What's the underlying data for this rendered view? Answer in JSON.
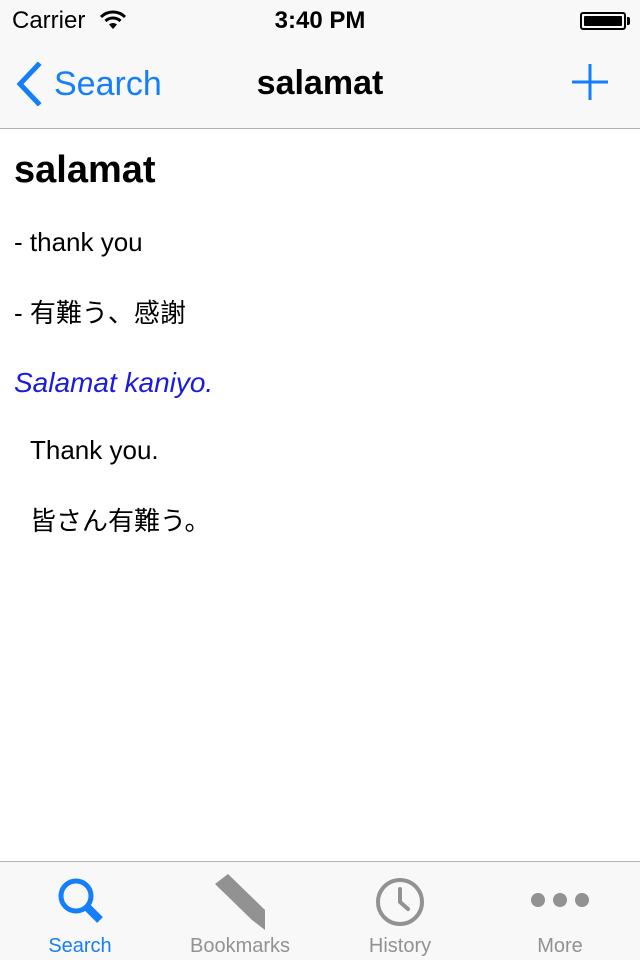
{
  "status_bar": {
    "carrier": "Carrier",
    "time": "3:40 PM",
    "battery_percent": 100
  },
  "navbar": {
    "back_label": "Search",
    "title": "salamat",
    "add_icon": "plus-icon"
  },
  "entry": {
    "headword": "salamat",
    "definitions": [
      "- thank you",
      "- 有難う、感謝"
    ],
    "example": {
      "sentence": "Salamat kaniyo.",
      "translations": [
        "Thank you.",
        "皆さん有難う。"
      ]
    }
  },
  "tabbar": {
    "tabs": [
      {
        "label": "Search",
        "icon": "search-icon",
        "active": true
      },
      {
        "label": "Bookmarks",
        "icon": "bookmark-icon",
        "active": false
      },
      {
        "label": "History",
        "icon": "clock-icon",
        "active": false
      },
      {
        "label": "More",
        "icon": "more-icon",
        "active": false
      }
    ]
  },
  "colors": {
    "accent": "#157efb",
    "example_text": "#1a1ae0",
    "inactive_tab": "#929292",
    "bar_background": "#f8f8f8"
  }
}
